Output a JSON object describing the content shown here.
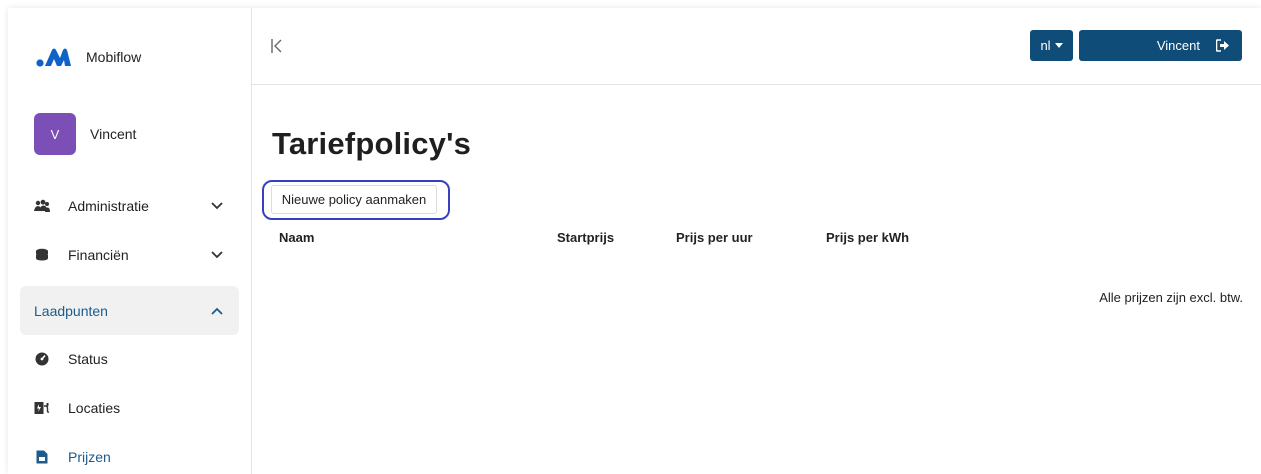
{
  "brand": {
    "name": "Mobiflow",
    "logo_color": "#0f63c7"
  },
  "user": {
    "initial": "V",
    "name": "Vincent",
    "avatar_color": "#7b4fb6"
  },
  "sidebar": {
    "items": [
      {
        "label": "Administratie",
        "icon": "users-icon",
        "expanded": false
      },
      {
        "label": "Financiën",
        "icon": "coins-icon",
        "expanded": false
      },
      {
        "label": "Laadpunten",
        "icon": "",
        "expanded": true
      },
      {
        "label": "Status",
        "icon": "gauge-icon"
      },
      {
        "label": "Locaties",
        "icon": "charging-station-icon"
      },
      {
        "label": "Prijzen",
        "icon": "price-tag-icon"
      }
    ]
  },
  "header": {
    "language": "nl",
    "user_button": "Vincent"
  },
  "main": {
    "title": "Tariefpolicy's",
    "new_button": "Nieuwe policy aanmaken",
    "table_headers": [
      "Naam",
      "Startprijs",
      "Prijs per uur",
      "Prijs per kWh"
    ],
    "note": "Alle prijzen zijn excl. btw."
  },
  "colors": {
    "primary": "#0f4c78",
    "accent_text": "#1c5b8c",
    "highlight_outline": "#3a3fc2"
  }
}
